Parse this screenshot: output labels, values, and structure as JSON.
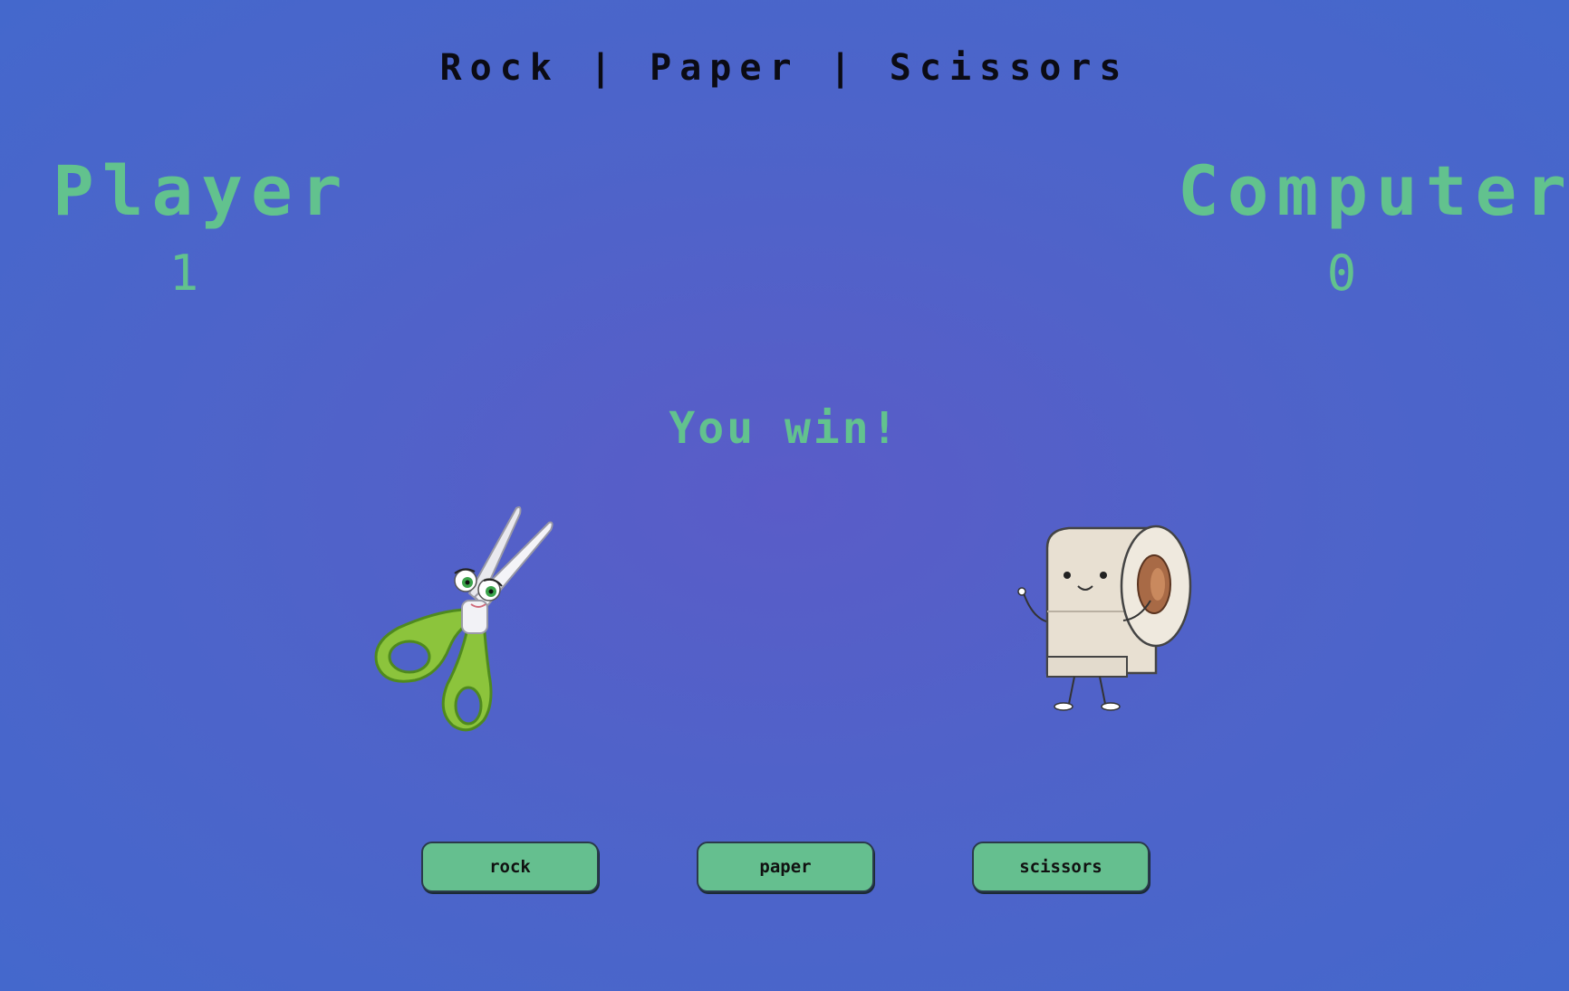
{
  "header": {
    "title": "Rock | Paper | Scissors"
  },
  "scoreboard": {
    "player": {
      "label": "Player",
      "score": "1"
    },
    "computer": {
      "label": "Computer",
      "score": "0"
    }
  },
  "round": {
    "result": "You win!",
    "player_choice_icon": "scissors-character",
    "computer_choice_icon": "paper-roll-character"
  },
  "controls": {
    "rock_label": "rock",
    "paper_label": "paper",
    "scissors_label": "scissors"
  },
  "colors": {
    "background": "#5a5cc8",
    "accent": "#62c28e",
    "button": "#65bf8f",
    "title": "#0b0b14"
  }
}
